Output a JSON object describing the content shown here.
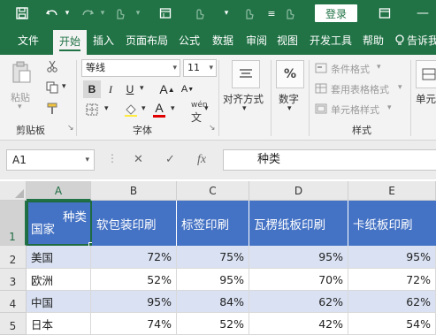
{
  "titlebar": {
    "login_label": "登录",
    "qat_icons": [
      "save-icon",
      "undo-icon",
      "redo-icon",
      "touch-mode-icon",
      "customize-qat-icon",
      "ribbon-display-icon"
    ]
  },
  "tabs": [
    {
      "label": "文件"
    },
    {
      "label": "开始",
      "active": true
    },
    {
      "label": "插入"
    },
    {
      "label": "页面布局"
    },
    {
      "label": "公式"
    },
    {
      "label": "数据"
    },
    {
      "label": "审阅"
    },
    {
      "label": "视图"
    },
    {
      "label": "开发工具"
    },
    {
      "label": "帮助"
    },
    {
      "label": "告诉我"
    }
  ],
  "ribbon": {
    "clipboard": {
      "paste_label": "粘贴",
      "group_label": "剪贴板"
    },
    "font": {
      "font_name": "等线",
      "font_size": "11",
      "bold": "B",
      "italic": "I",
      "underline": "U",
      "grow": "A",
      "shrink": "A",
      "phonetic": "wén",
      "font_color_letter": "A",
      "font_color": "#e00000",
      "group_label": "字体"
    },
    "alignment": {
      "label": "对齐方式"
    },
    "number": {
      "label": "数字",
      "symbol": "%"
    },
    "styles": {
      "items": [
        "条件格式",
        "套用表格格式",
        "单元格样式"
      ],
      "group_label": "样式"
    },
    "cells": {
      "label": "单元"
    }
  },
  "formula_bar": {
    "name_box": "A1",
    "cancel_symbol": "✕",
    "enter_symbol": "✓",
    "fx_symbol": "fx",
    "content": "种类"
  },
  "grid": {
    "columns": [
      "A",
      "B",
      "C",
      "D",
      "E"
    ],
    "rows": [
      "1",
      "2",
      "3",
      "4",
      "5"
    ],
    "header_cell_a1": {
      "top": "种类",
      "bottom": "国家"
    },
    "headers": [
      "软包装印刷",
      "标签印刷",
      "瓦楞纸板印刷",
      "卡纸板印刷"
    ],
    "data": [
      {
        "country": "美国",
        "values": [
          "72%",
          "75%",
          "95%",
          "95%"
        ]
      },
      {
        "country": "欧洲",
        "values": [
          "52%",
          "95%",
          "70%",
          "72%"
        ]
      },
      {
        "country": "中国",
        "values": [
          "95%",
          "84%",
          "62%",
          "62%"
        ]
      },
      {
        "country": "日本",
        "values": [
          "74%",
          "52%",
          "42%",
          "54%"
        ]
      }
    ],
    "colors": {
      "header_fill": "#4472c4",
      "band_fill": "#d9e1f2",
      "accent": "#217346"
    }
  }
}
